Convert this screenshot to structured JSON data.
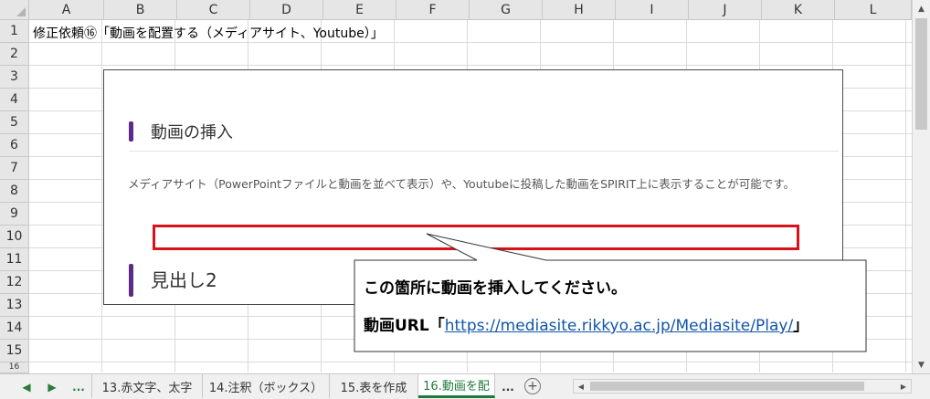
{
  "columns": [
    "A",
    "B",
    "C",
    "D",
    "E",
    "F",
    "G",
    "H",
    "I",
    "J",
    "K",
    "L"
  ],
  "rows": [
    "1",
    "2",
    "3",
    "4",
    "5",
    "6",
    "7",
    "8",
    "9",
    "10",
    "11",
    "12",
    "13",
    "14",
    "15",
    "16"
  ],
  "cell_a1": "修正依頼⑯「動画を配置する（メディアサイト、Youtube）」",
  "panel": {
    "heading": "動画の挿入",
    "body": "メディアサイト（PowerPointファイルと動画を並べて表示）や、Youtubeに投稿した動画をSPIRIT上に表示することが可能です。",
    "heading2": "見出し2"
  },
  "callout": {
    "line1": "この箇所に動画を挿入してください。",
    "line2_prefix": "動画URL「",
    "line2_link": "https://mediasite.rikkyo.ac.jp/Mediasite/Play/",
    "line2_suffix": "」"
  },
  "tabs": {
    "nav_first": "◀",
    "nav_next": "▶",
    "ellipsis_left": "...",
    "items": [
      "13.赤文字、太字",
      "14.注釈（ボックス）",
      "15.表を作成",
      "16.動画を配"
    ],
    "ellipsis_right": "...",
    "add": "+"
  },
  "colors": {
    "accent_purple": "#5b2a8a",
    "highlight_red": "#d6121a",
    "excel_green": "#1f7a3a",
    "link_blue": "#1155aa"
  }
}
